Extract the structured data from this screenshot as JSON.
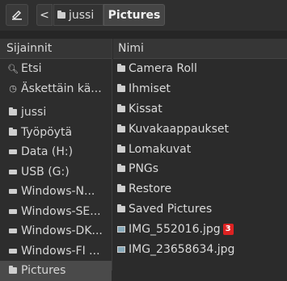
{
  "toolbar": {
    "back_label": "<",
    "breadcrumb": [
      "jussi",
      "Pictures"
    ]
  },
  "sidebar": {
    "header": "Sijainnit",
    "items": [
      {
        "label": "Etsi",
        "icon": "search-icon"
      },
      {
        "label": "Äskettäin kä...",
        "icon": "clock-icon"
      },
      {
        "label": "jussi",
        "icon": "folder-icon"
      },
      {
        "label": "Työpöytä",
        "icon": "folder-icon"
      },
      {
        "label": "Data (H:)",
        "icon": "drive-icon"
      },
      {
        "label": "USB (G:)",
        "icon": "drive-icon"
      },
      {
        "label": "Windows-N...",
        "icon": "drive-icon"
      },
      {
        "label": "Windows-SE...",
        "icon": "drive-icon"
      },
      {
        "label": "Windows-DK...",
        "icon": "drive-icon"
      },
      {
        "label": "Windows-FI ...",
        "icon": "drive-icon"
      },
      {
        "label": "Pictures",
        "icon": "folder-icon"
      }
    ]
  },
  "main": {
    "header": "Nimi",
    "files": [
      {
        "name": "Camera Roll",
        "icon": "folder-icon"
      },
      {
        "name": "Ihmiset",
        "icon": "folder-icon"
      },
      {
        "name": "Kissat",
        "icon": "folder-icon"
      },
      {
        "name": "Kuvakaappaukset",
        "icon": "folder-icon"
      },
      {
        "name": "Lomakuvat",
        "icon": "folder-icon"
      },
      {
        "name": "PNGs",
        "icon": "folder-icon"
      },
      {
        "name": "Restore",
        "icon": "folder-icon"
      },
      {
        "name": "Saved Pictures",
        "icon": "folder-icon"
      },
      {
        "name": "IMG_552016.jpg",
        "icon": "image-icon",
        "badge": "3"
      },
      {
        "name": "IMG_23658634.jpg",
        "icon": "image-icon"
      }
    ]
  }
}
